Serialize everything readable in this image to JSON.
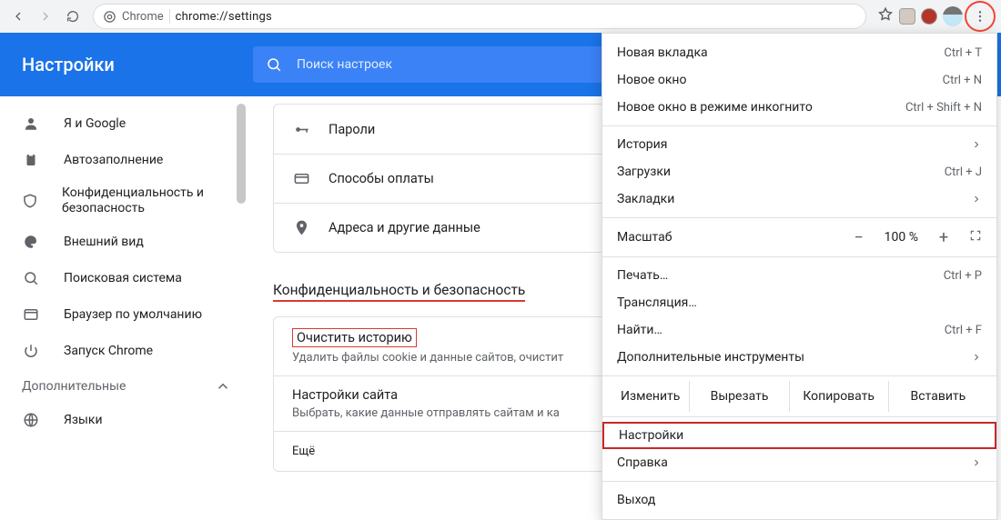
{
  "toolbar": {
    "site_label": "Chrome",
    "url": "chrome://settings"
  },
  "bluebar": {
    "title": "Настройки",
    "search_placeholder": "Поиск настроек"
  },
  "sidebar": {
    "items": [
      {
        "label": "Я и Google"
      },
      {
        "label": "Автозаполнение"
      },
      {
        "label": "Конфиденциальность и безопасность"
      },
      {
        "label": "Внешний вид"
      },
      {
        "label": "Поисковая система"
      },
      {
        "label": "Браузер по умолчанию"
      },
      {
        "label": "Запуск Chrome"
      }
    ],
    "advanced": "Дополнительные",
    "extra": [
      {
        "label": "Языки"
      }
    ]
  },
  "main": {
    "autofill": [
      {
        "label": "Пароли"
      },
      {
        "label": "Способы оплаты"
      },
      {
        "label": "Адреса и другие данные"
      }
    ],
    "privacy_title": "Конфиденциальность и безопасность",
    "clear": {
      "title": "Очистить историю",
      "sub": "Удалить файлы cookie и данные сайтов, очистит"
    },
    "site": {
      "title": "Настройки сайта",
      "sub": "Выбрать, какие данные отправлять сайтам и ка"
    },
    "more": "Ещё"
  },
  "menu": {
    "new_tab": {
      "label": "Новая вкладка",
      "shortcut": "Ctrl + T"
    },
    "new_window": {
      "label": "Новое окно",
      "shortcut": "Ctrl + N"
    },
    "incognito": {
      "label": "Новое окно в режиме инкогнито",
      "shortcut": "Ctrl + Shift + N"
    },
    "history": {
      "label": "История"
    },
    "downloads": {
      "label": "Загрузки",
      "shortcut": "Ctrl + J"
    },
    "bookmarks": {
      "label": "Закладки"
    },
    "zoom": {
      "label": "Масштаб",
      "value": "100 %"
    },
    "print": {
      "label": "Печать…",
      "shortcut": "Ctrl + P"
    },
    "cast": {
      "label": "Трансляция…"
    },
    "find": {
      "label": "Найти…",
      "shortcut": "Ctrl + F"
    },
    "more_tools": {
      "label": "Дополнительные инструменты"
    },
    "edit": {
      "label": "Изменить",
      "cut": "Вырезать",
      "copy": "Копировать",
      "paste": "Вставить"
    },
    "settings": {
      "label": "Настройки"
    },
    "help": {
      "label": "Справка"
    },
    "exit": {
      "label": "Выход"
    }
  }
}
